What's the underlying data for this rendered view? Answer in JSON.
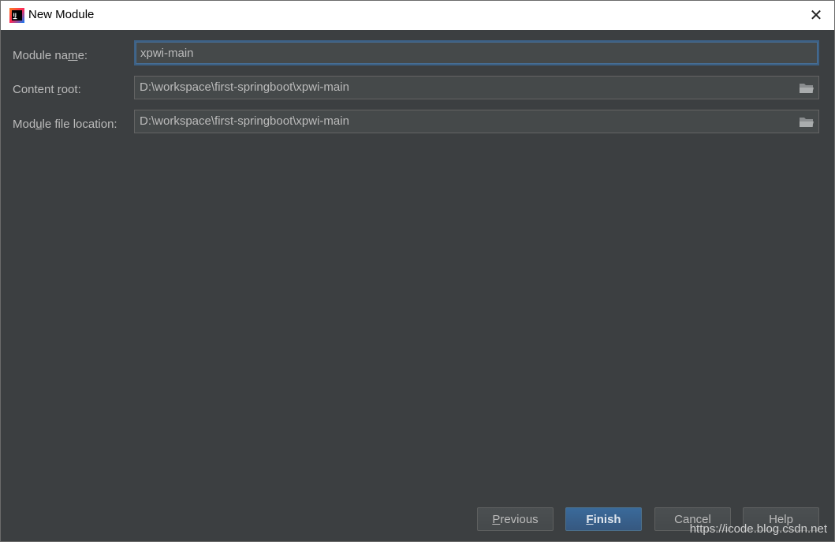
{
  "window": {
    "title": "New Module",
    "close_glyph": "✕",
    "icon_text": "IJ"
  },
  "form": {
    "module_name": {
      "label_before": "Module na",
      "label_mnemonic": "m",
      "label_after": "e:",
      "value": "xpwi-main"
    },
    "content_root": {
      "label_before": "Content ",
      "label_mnemonic": "r",
      "label_after": "oot:",
      "value": "D:\\workspace\\first-springboot\\xpwi-main"
    },
    "module_file_location": {
      "label_before": "Mod",
      "label_mnemonic": "u",
      "label_after": "le file location:",
      "value": "D:\\workspace\\first-springboot\\xpwi-main"
    }
  },
  "buttons": {
    "previous": {
      "mnemonic": "P",
      "rest": "revious"
    },
    "finish": {
      "mnemonic": "F",
      "rest": "inish"
    },
    "cancel": {
      "mnemonic": "",
      "rest": "Cancel"
    },
    "help": {
      "mnemonic": "",
      "rest": "Help"
    }
  },
  "watermark": "https://icode.blog.csdn.net",
  "colors": {
    "background": "#3c3f41",
    "field_bg": "#45494a",
    "focus_border": "#3d6185",
    "primary_button": "#365880",
    "text": "#bbbbbb"
  }
}
